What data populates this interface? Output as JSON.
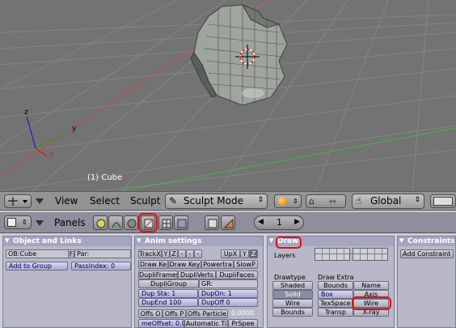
{
  "viewport": {
    "object_label": "(1) Cube",
    "axes": {
      "x": "x",
      "y": "y",
      "z": "z"
    }
  },
  "view_header": {
    "menus": [
      "View",
      "Select",
      "Sculpt"
    ],
    "mode": "Sculpt Mode",
    "orientation": "Global"
  },
  "buttons_header": {
    "panels_label": "Panels",
    "frame": "1"
  },
  "object_links": {
    "title": "Object and Links",
    "ob_field": "OB:Cube",
    "f_btn": "F",
    "par_field": "Par:",
    "add_group": "Add to Group",
    "pass_index": "PassIndex: 0"
  },
  "anim_settings": {
    "title": "Anim settings",
    "track_x": "TrackX",
    "track_y": "Y",
    "track_z": "Z",
    "dash1": "-",
    "dash2": "-",
    "dash3": "-",
    "up_x": "UpX",
    "up_y": "Y",
    "up_z": "Z",
    "draw_key": "Draw Ke",
    "draw_key_sel": "Draw Key",
    "powertrack": "Powertra",
    "slowpar": "SlowP",
    "dupli_frames": "DupliFrames",
    "dupli_verts": "DupliVerts",
    "dupli_faces": "DupliFaces",
    "dupli_group": "DupliGroup",
    "gr_field": "GR:",
    "dup_sta": "Dup Sta: 1",
    "dup_on": "DupOn: 1",
    "dup_end": "DupEnd 100",
    "dup_off": "DupOff 0",
    "offs_ob": "Offs O",
    "offs_par": "Offs P",
    "offs_particle": "Offs Particle",
    "offs_value": "0.0000",
    "time_offset": "meOffset: 0.00",
    "automatic": "Automatic Ti",
    "prspeed": "PrSpee"
  },
  "draw": {
    "title": "Draw",
    "layers_label": "Layers",
    "drawtype_label": "Drawtype",
    "drawtypes": [
      "Shaded",
      "Solid",
      "Wire",
      "Bounds"
    ],
    "selected_drawtype": "Solid",
    "draw_extra_label": "Draw Extra",
    "extras": [
      "Bounds",
      "Name",
      "Box",
      "Axis",
      "TexSpace",
      "Wire",
      "Transp",
      "X-ray"
    ]
  },
  "constraints": {
    "title": "Constraints",
    "add": "Add Constraint"
  },
  "colors": {
    "grid": "#6a6a6a",
    "x_axis": "#d02020",
    "y_axis": "#40c040",
    "z_axis": "#2020c0",
    "highlight": "#e01010"
  }
}
